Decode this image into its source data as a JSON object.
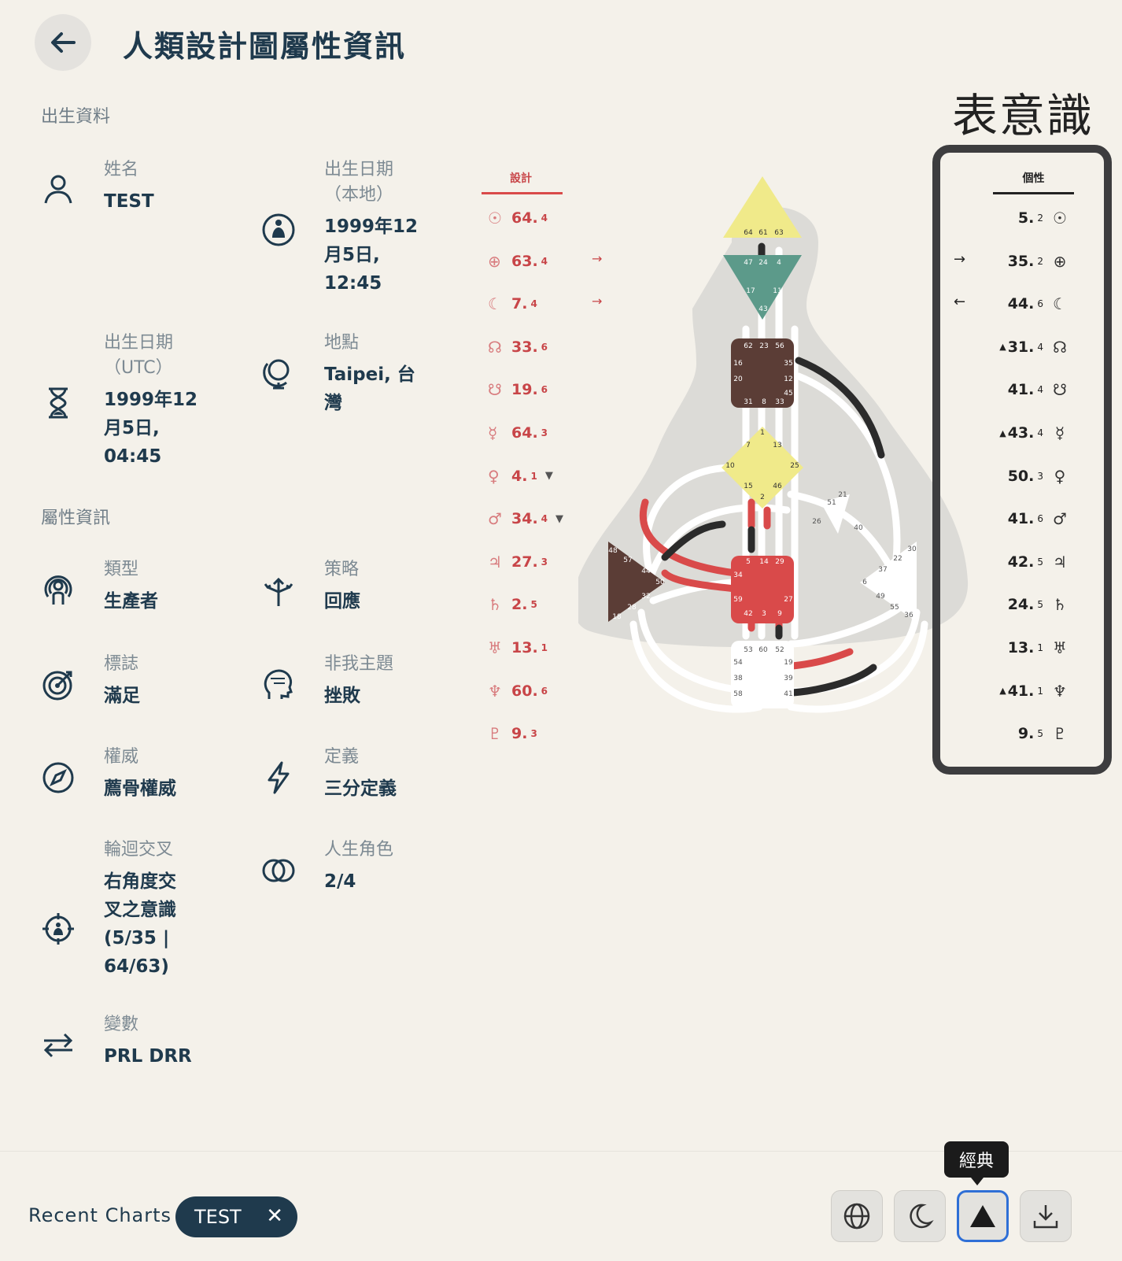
{
  "header": {
    "title": "人類設計圖屬性資訊"
  },
  "sections": {
    "birth": "出生資料",
    "attributes": "屬性資訊"
  },
  "fields": {
    "name": {
      "label": "姓名",
      "value": "TEST"
    },
    "birth_local": {
      "label": "出生日期（本地）",
      "value": "1999年12月5日, 12:45"
    },
    "birth_utc": {
      "label": "出生日期（UTC）",
      "value": "1999年12月5日, 04:45"
    },
    "location": {
      "label": "地點",
      "value": "Taipei, 台灣"
    },
    "type": {
      "label": "類型",
      "value": "生產者"
    },
    "strategy": {
      "label": "策略",
      "value": "回應"
    },
    "signature": {
      "label": "標誌",
      "value": "滿足"
    },
    "not_self": {
      "label": "非我主題",
      "value": "挫敗"
    },
    "authority": {
      "label": "權威",
      "value": "薦骨權威"
    },
    "definition": {
      "label": "定義",
      "value": "三分定義"
    },
    "cross": {
      "label": "輪迴交叉",
      "value": "右角度交叉之意識 (5/35 | 64/63)"
    },
    "profile": {
      "label": "人生角色",
      "value": "2/4"
    },
    "variable": {
      "label": "變數",
      "value": "PRL DRR"
    }
  },
  "design": {
    "header": "設計",
    "rows": [
      {
        "planet": "sun",
        "gate": "64.",
        "line": "4",
        "mark": ""
      },
      {
        "planet": "earth",
        "gate": "63.",
        "line": "4",
        "mark": "→"
      },
      {
        "planet": "moon",
        "gate": "7.",
        "line": "4",
        "mark": "→"
      },
      {
        "planet": "north-node",
        "gate": "33.",
        "line": "6",
        "mark": ""
      },
      {
        "planet": "south-node",
        "gate": "19.",
        "line": "6",
        "mark": ""
      },
      {
        "planet": "mercury",
        "gate": "64.",
        "line": "3",
        "mark": ""
      },
      {
        "planet": "venus",
        "gate": "4.",
        "line": "1",
        "mark": "▼"
      },
      {
        "planet": "mars",
        "gate": "34.",
        "line": "4",
        "mark": "▼"
      },
      {
        "planet": "jupiter",
        "gate": "27.",
        "line": "3",
        "mark": ""
      },
      {
        "planet": "saturn",
        "gate": "2.",
        "line": "5",
        "mark": ""
      },
      {
        "planet": "uranus",
        "gate": "13.",
        "line": "1",
        "mark": ""
      },
      {
        "planet": "neptune",
        "gate": "60.",
        "line": "6",
        "mark": ""
      },
      {
        "planet": "pluto",
        "gate": "9.",
        "line": "3",
        "mark": ""
      }
    ]
  },
  "personality": {
    "title": "表意識",
    "header": "個性",
    "rows": [
      {
        "planet": "sun",
        "gate": "5.",
        "line": "2",
        "mark": ""
      },
      {
        "planet": "earth",
        "gate": "35.",
        "line": "2",
        "mark": "→"
      },
      {
        "planet": "moon",
        "gate": "44.",
        "line": "6",
        "mark": "←"
      },
      {
        "planet": "north-node",
        "gate": "31.",
        "line": "4",
        "mark": "▲"
      },
      {
        "planet": "south-node",
        "gate": "41.",
        "line": "4",
        "mark": ""
      },
      {
        "planet": "mercury",
        "gate": "43.",
        "line": "4",
        "mark": "▲"
      },
      {
        "planet": "venus",
        "gate": "50.",
        "line": "3",
        "mark": ""
      },
      {
        "planet": "mars",
        "gate": "41.",
        "line": "6",
        "mark": ""
      },
      {
        "planet": "jupiter",
        "gate": "42.",
        "line": "5",
        "mark": ""
      },
      {
        "planet": "saturn",
        "gate": "24.",
        "line": "5",
        "mark": ""
      },
      {
        "planet": "uranus",
        "gate": "13.",
        "line": "1",
        "mark": ""
      },
      {
        "planet": "neptune",
        "gate": "41.",
        "line": "1",
        "mark": "▲"
      },
      {
        "planet": "pluto",
        "gate": "9.",
        "line": "5",
        "mark": ""
      }
    ]
  },
  "planet_glyphs": {
    "sun": "☉",
    "earth": "⊕",
    "moon": "☾",
    "north-node": "☊",
    "south-node": "☋",
    "mercury": "☿",
    "venus": "♀",
    "mars": "♂",
    "jupiter": "♃",
    "saturn": "♄",
    "uranus": "♅",
    "neptune": "♆",
    "pluto": "♇"
  },
  "bodygraph": {
    "colors": {
      "head": "#f0ea8a",
      "ajna": "#5c9a8a",
      "throat": "#5b3d36",
      "g": "#f0ea8a",
      "sacral": "#d94a4a",
      "spleen": "#5b3d36",
      "root": "#ffffff",
      "solar": "#ffffff",
      "heart": "#ffffff",
      "design": "#d94a4a",
      "personality": "#2b2b2b",
      "channel": "#ffffff",
      "silhouette": "#dcdbd7"
    },
    "head_gates": [
      "64",
      "61",
      "63"
    ],
    "ajna_gates": [
      "47",
      "24",
      "4",
      "17",
      "11",
      "43"
    ],
    "throat_gates": [
      "62",
      "23",
      "56",
      "16",
      "35",
      "20",
      "12",
      "45",
      "31",
      "8",
      "33"
    ],
    "g_gates": [
      "1",
      "7",
      "13",
      "10",
      "25",
      "15",
      "46",
      "2"
    ],
    "sacral_gates": [
      "5",
      "14",
      "29",
      "34",
      "27",
      "59",
      "42",
      "3",
      "9"
    ],
    "root_gates": [
      "53",
      "60",
      "52",
      "54",
      "19",
      "38",
      "39",
      "58",
      "41"
    ],
    "spleen_gates": [
      "48",
      "57",
      "44",
      "50",
      "32",
      "28",
      "18"
    ],
    "heart_gates": [
      "21",
      "51",
      "26",
      "40"
    ],
    "solar_gates": [
      "22",
      "37",
      "6",
      "49",
      "55",
      "36",
      "30"
    ]
  },
  "footer": {
    "recent_label": "Recent Charts",
    "chip": "TEST",
    "tooltip": "經典",
    "tools": [
      "globe-icon",
      "moon-icon",
      "triangle-icon",
      "download-icon"
    ]
  }
}
